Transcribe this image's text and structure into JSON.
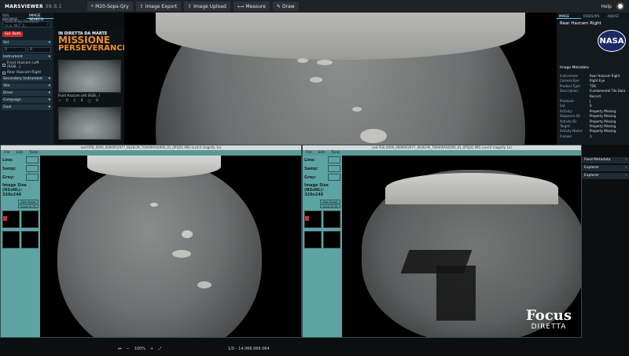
{
  "topbar": {
    "app_name": "MARSVIEWER",
    "version": "98.8.1",
    "tools": [
      "M20-Sops-Qry",
      "Image Export",
      "Image Upload",
      "Measure",
      "Draw"
    ],
    "help": "Help"
  },
  "leftpanel": {
    "tabs": [
      "SOL BROWSE",
      "IMAGE SEARCH"
    ],
    "search_placeholder": "Search by filename (e.g. NLF_0...",
    "filter_chip": "Sol: Both",
    "sections": {
      "sol": "Sol",
      "instrument": "Instrument",
      "secondary_instrument": "Secondary Instrument",
      "site": "Site",
      "drive": "Drive",
      "campaign": "Campaign",
      "goal": "Goal"
    },
    "sol_min": "0",
    "sol_max": "0",
    "instruments": [
      "Front Hazcam Left (RGB...)",
      "Rear Hazcam Right"
    ]
  },
  "thumbs": {
    "overlay_small": "IN DIRETTA DA MARTE",
    "overlay_big1": "MISSIONE",
    "overlay_big2": "PERSEVERANCE",
    "label1": "Front Hazcam Left (RGB...)",
    "label2": "",
    "actions": [
      "0",
      "0",
      "0"
    ]
  },
  "rightpanel": {
    "tabs": [
      "IMAGE",
      "OVERLAYS",
      "ADJUST"
    ],
    "title": "Rear Hazcam Right",
    "meta_title": "Image Metadata",
    "metadata": [
      {
        "k": "Instrument:",
        "v": "Rear Hazcam Right"
      },
      {
        "k": "Camera Eye:",
        "v": "Right Eye"
      },
      {
        "k": "Product Type:",
        "v": "TDS"
      },
      {
        "k": "Description:",
        "v": "Fundamental Tile Data Record"
      },
      {
        "k": "Producer:",
        "v": "J"
      },
      {
        "k": "Sol:",
        "v": "0"
      },
      {
        "k": "Activity:",
        "v": "Property Missing"
      },
      {
        "k": "Sequence ID:",
        "v": "Property Missing"
      },
      {
        "k": "Activity ID:",
        "v": "Property Missing"
      },
      {
        "k": "Target:",
        "v": "Property Missing"
      },
      {
        "k": "Activity Name:",
        "v": "Property Missing"
      },
      {
        "k": "Frames:",
        "v": "1"
      }
    ]
  },
  "rightmenu": [
    "Feed Metadata",
    "Explorer",
    "Explorer"
  ],
  "viewer_left": {
    "title": "xvd  RRB_0000_0666952977_662ECM_T0000RAS0000_01_0P1J01.IMG  (xvd:0 magnify 1x)",
    "menus": [
      "File",
      "Edit",
      "Tools"
    ],
    "labels": {
      "line": "Line:",
      "samp": "Samp:",
      "grey": "Grey:"
    },
    "image_size_label": "Image Size (NSxNL):",
    "image_size": "320x240",
    "zoom_factor": "Size Factor",
    "zoom_btn": "Scale To Fit"
  },
  "viewer_right": {
    "title": "xvd  FLB_0000_0666952977_663ECM_T0000RAS0000_01_0P1J01.IMG  (xvd:0 magnify 1x)",
    "menus": [
      "File",
      "Edit",
      "Tools"
    ],
    "labels": {
      "line": "Line:",
      "samp": "Samp:",
      "grey": "Grey:"
    },
    "image_size_label": "Image Size (NSxNL):",
    "image_size": "320x240",
    "zoom_factor": "Size Factor",
    "zoom_btn": "Scale To Fit"
  },
  "branding": {
    "focus": "Focus",
    "diretta": "DIRETTA"
  },
  "bottombar": {
    "zoom": "100%",
    "position": "1/0 - 14.066.066.064"
  }
}
